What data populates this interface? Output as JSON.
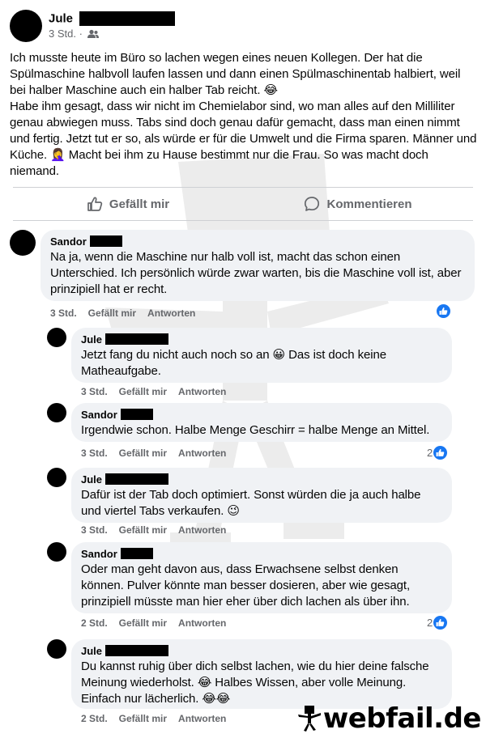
{
  "post": {
    "author": "Jule",
    "time": "3 Std. ·",
    "text": "Ich musste heute im Büro so lachen wegen eines neuen Kollegen. Der hat die Spülmaschine halbvoll laufen lassen und dann einen Spülmaschinentab halbiert, weil bei halber Maschine auch ein halber Tab reicht. 😂\nHabe ihm gesagt, dass wir nicht im Chemielabor sind, wo man alles auf den Milliliter genau abwiegen muss. Tabs sind doch genau dafür gemacht, dass man einen nimmt und fertig. Jetzt tut er so, als würde er für die Umwelt und die Firma sparen. Männer und Küche. 🤦‍♀️ Macht bei ihm zu Hause bestimmt nur die Frau. So was macht doch niemand."
  },
  "actions": {
    "like_label": "Gefällt mir",
    "comment_label": "Kommentieren"
  },
  "comments": [
    {
      "author": "Sandor",
      "text": "Na ja, wenn die Maschine nur halb voll ist, macht das schon einen Unterschied. Ich persönlich würde zwar warten, bis die Maschine voll ist, aber prinzipiell hat er recht.",
      "time": "3 Std.",
      "like": "Gefällt mir",
      "reply": "Antworten",
      "likes": ""
    },
    {
      "author": "Jule",
      "text": "Jetzt fang du nicht auch noch so an 😀 Das ist doch keine Matheaufgabe.",
      "time": "3 Std.",
      "like": "Gefällt mir",
      "reply": "Antworten",
      "likes": ""
    },
    {
      "author": "Sandor",
      "text": "Irgendwie schon. Halbe Menge Geschirr = halbe Menge an Mittel.",
      "time": "3 Std.",
      "like": "Gefällt mir",
      "reply": "Antworten",
      "likes": "2"
    },
    {
      "author": "Jule",
      "text": "Dafür ist der Tab doch optimiert. Sonst würden die ja auch halbe und viertel Tabs verkaufen. 😉",
      "time": "3 Std.",
      "like": "Gefällt mir",
      "reply": "Antworten",
      "likes": ""
    },
    {
      "author": "Sandor",
      "text": "Oder man geht davon aus, dass Erwachsene selbst denken können. Pulver könnte man besser dosieren, aber wie gesagt, prinzipiell müsste man hier eher über dich lachen als über ihn.",
      "time": "2 Std.",
      "like": "Gefällt mir",
      "reply": "Antworten",
      "likes": "2"
    },
    {
      "author": "Jule",
      "text": "Du kannst ruhig über dich selbst lachen, wie du hier deine falsche Meinung wiederholst. 😂 Halbes Wissen, aber volle Meinung. Einfach nur lächerlich. 😂😂",
      "time": "2 Std.",
      "like": "Gefällt mir",
      "reply": "Antworten",
      "likes": ""
    }
  ],
  "watermark": {
    "brand": "webfail.de"
  },
  "colors": {
    "bubble": "#f0f2f5",
    "meta_text": "#65676b",
    "like_blue": "#1877f2"
  },
  "icons": [
    "friends-audience-icon",
    "thumbs-up-icon",
    "comment-icon",
    "like-reaction-icon",
    "webfail-mascot-icon"
  ]
}
